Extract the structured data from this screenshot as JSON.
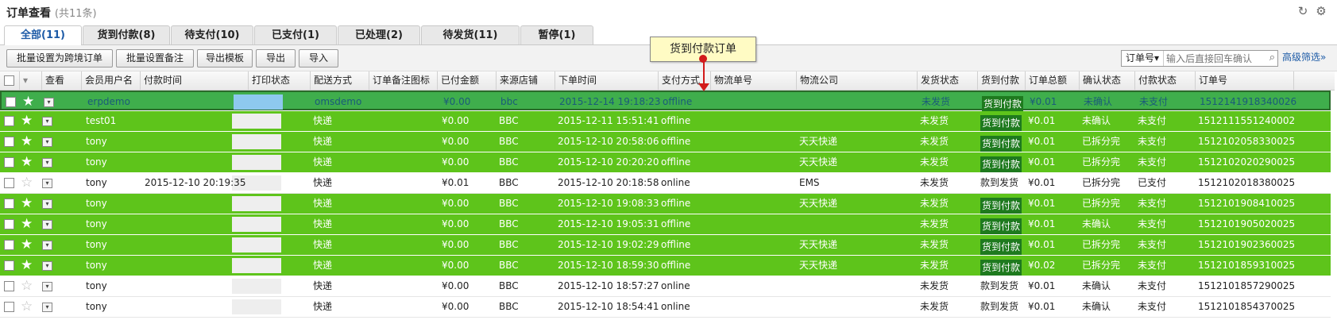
{
  "header": {
    "title": "订单查看",
    "count": "(共11条)",
    "icons": [
      "refresh-icon",
      "gear-icon"
    ]
  },
  "tabs": [
    "全部(11)",
    "货到付款(8)",
    "待支付(10)",
    "已支付(1)",
    "已处理(2)",
    "待发货(11)",
    "暂停(1)"
  ],
  "active_tab": 0,
  "toolbar": {
    "buttons": [
      "批量设置为跨境订单",
      "批量设置备注",
      "导出模板",
      "导出",
      "导入"
    ],
    "search_select": "订单号▾",
    "search_placeholder": "输入后直接回车确认",
    "advanced": "高级筛选»"
  },
  "tooltip": "货到付款订单",
  "columns": [
    "查看",
    "会员用户名",
    "付款时间",
    "打印状态",
    "配送方式",
    "订单备注图标",
    "已付金额",
    "来源店铺",
    "下单时间",
    "支付方式",
    "物流单号",
    "物流公司",
    "发货状态",
    "货到付款",
    "订单总额",
    "确认状态",
    "付款状态",
    "订单号"
  ],
  "rows": [
    {
      "style": "sel",
      "user": "erpdemo",
      "paytime": "",
      "ship": "omsdemo",
      "paid": "¥0.00",
      "shop": "bbc",
      "ordertime": "2015-12-14 19:18:23",
      "method": "offline",
      "company": "",
      "status": "未发货",
      "cod": "货到付款",
      "cod_badge": true,
      "total": "¥0.01",
      "confirm": "未确认",
      "pay": "未支付",
      "orderno": "1512141918340026"
    },
    {
      "style": "green",
      "user": "test01",
      "paytime": "",
      "ship": "快递",
      "paid": "¥0.00",
      "shop": "BBC",
      "ordertime": "2015-12-11 15:51:41",
      "method": "offline",
      "company": "",
      "status": "未发货",
      "cod": "货到付款",
      "cod_badge": true,
      "total": "¥0.01",
      "confirm": "未确认",
      "pay": "未支付",
      "orderno": "1512111551240002"
    },
    {
      "style": "green",
      "user": "tony",
      "paytime": "",
      "ship": "快递",
      "paid": "¥0.00",
      "shop": "BBC",
      "ordertime": "2015-12-10 20:58:06",
      "method": "offline",
      "company": "天天快递",
      "status": "未发货",
      "cod": "货到付款",
      "cod_badge": true,
      "total": "¥0.01",
      "confirm": "已拆分完",
      "pay": "未支付",
      "orderno": "1512102058330025"
    },
    {
      "style": "green",
      "user": "tony",
      "paytime": "",
      "ship": "快递",
      "paid": "¥0.00",
      "shop": "BBC",
      "ordertime": "2015-12-10 20:20:20",
      "method": "offline",
      "company": "天天快递",
      "status": "未发货",
      "cod": "货到付款",
      "cod_badge": true,
      "total": "¥0.01",
      "confirm": "已拆分完",
      "pay": "未支付",
      "orderno": "1512102020290025"
    },
    {
      "style": "white",
      "user": "tony",
      "paytime": "2015-12-10 20:19:35",
      "ship": "快递",
      "paid": "¥0.01",
      "shop": "BBC",
      "ordertime": "2015-12-10 20:18:58",
      "method": "online",
      "company": "EMS",
      "status": "未发货",
      "cod": "款到发货",
      "cod_badge": false,
      "total": "¥0.01",
      "confirm": "已拆分完",
      "pay": "已支付",
      "orderno": "1512102018380025"
    },
    {
      "style": "green",
      "user": "tony",
      "paytime": "",
      "ship": "快递",
      "paid": "¥0.00",
      "shop": "BBC",
      "ordertime": "2015-12-10 19:08:33",
      "method": "offline",
      "company": "天天快递",
      "status": "未发货",
      "cod": "货到付款",
      "cod_badge": true,
      "total": "¥0.01",
      "confirm": "已拆分完",
      "pay": "未支付",
      "orderno": "1512101908410025"
    },
    {
      "style": "green",
      "user": "tony",
      "paytime": "",
      "ship": "快递",
      "paid": "¥0.00",
      "shop": "BBC",
      "ordertime": "2015-12-10 19:05:31",
      "method": "offline",
      "company": "",
      "status": "未发货",
      "cod": "货到付款",
      "cod_badge": true,
      "total": "¥0.01",
      "confirm": "未确认",
      "pay": "未支付",
      "orderno": "1512101905020025"
    },
    {
      "style": "green",
      "user": "tony",
      "paytime": "",
      "ship": "快递",
      "paid": "¥0.00",
      "shop": "BBC",
      "ordertime": "2015-12-10 19:02:29",
      "method": "offline",
      "company": "天天快递",
      "status": "未发货",
      "cod": "货到付款",
      "cod_badge": true,
      "total": "¥0.01",
      "confirm": "已拆分完",
      "pay": "未支付",
      "orderno": "1512101902360025"
    },
    {
      "style": "green",
      "user": "tony",
      "paytime": "",
      "ship": "快递",
      "paid": "¥0.00",
      "shop": "BBC",
      "ordertime": "2015-12-10 18:59:30",
      "method": "offline",
      "company": "天天快递",
      "status": "未发货",
      "cod": "货到付款",
      "cod_badge": true,
      "total": "¥0.02",
      "confirm": "已拆分完",
      "pay": "未支付",
      "orderno": "1512101859310025"
    },
    {
      "style": "white",
      "user": "tony",
      "paytime": "",
      "ship": "快递",
      "paid": "¥0.00",
      "shop": "BBC",
      "ordertime": "2015-12-10 18:57:27",
      "method": "online",
      "company": "",
      "status": "未发货",
      "cod": "款到发货",
      "cod_badge": false,
      "total": "¥0.01",
      "confirm": "未确认",
      "pay": "未支付",
      "orderno": "1512101857290025"
    },
    {
      "style": "white",
      "user": "tony",
      "paytime": "",
      "ship": "快递",
      "paid": "¥0.00",
      "shop": "BBC",
      "ordertime": "2015-12-10 18:54:41",
      "method": "online",
      "company": "",
      "status": "未发货",
      "cod": "款到发货",
      "cod_badge": false,
      "total": "¥0.01",
      "confirm": "未确认",
      "pay": "未支付",
      "orderno": "1512101854370025"
    }
  ]
}
